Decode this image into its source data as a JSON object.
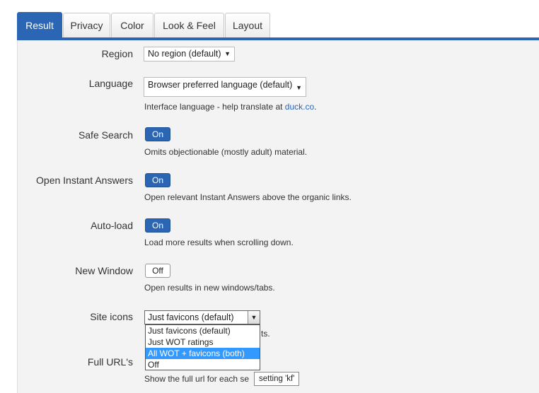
{
  "tabs": [
    {
      "label": "Result",
      "active": true
    },
    {
      "label": "Privacy",
      "active": false
    },
    {
      "label": "Color",
      "active": false
    },
    {
      "label": "Look & Feel",
      "active": false
    },
    {
      "label": "Layout",
      "active": false
    }
  ],
  "settings": {
    "region": {
      "label": "Region",
      "value": "No region (default)"
    },
    "language": {
      "label": "Language",
      "value": "Browser preferred language (default)",
      "hint_text": "Interface language - help translate at ",
      "hint_link": "duck.co",
      "hint_end": "."
    },
    "safe_search": {
      "label": "Safe Search",
      "toggle": "On",
      "hint": "Omits objectionable (mostly adult) material."
    },
    "instant_answers": {
      "label": "Open Instant Answers",
      "toggle": "On",
      "hint": "Open relevant Instant Answers above the organic links."
    },
    "auto_load": {
      "label": "Auto-load",
      "toggle": "On",
      "hint": "Load more results when scrolling down."
    },
    "new_window": {
      "label": "New Window",
      "toggle": "Off",
      "hint": "Open results in new windows/tabs."
    },
    "site_icons": {
      "label": "Site icons",
      "value": "Just favicons (default)",
      "hint_tail": "ts.",
      "options": [
        "Just favicons (default)",
        "Just WOT ratings",
        "All WOT + favicons (both)",
        "Off"
      ],
      "highlighted_option": "All WOT + favicons (both)"
    },
    "full_urls": {
      "label": "Full URL's",
      "hint": "Show the full url for each se"
    }
  },
  "tooltip": "setting 'kf'",
  "colors": {
    "accent": "#2b66b5",
    "highlight": "#3399ff",
    "panel": "#f3f3f3"
  }
}
